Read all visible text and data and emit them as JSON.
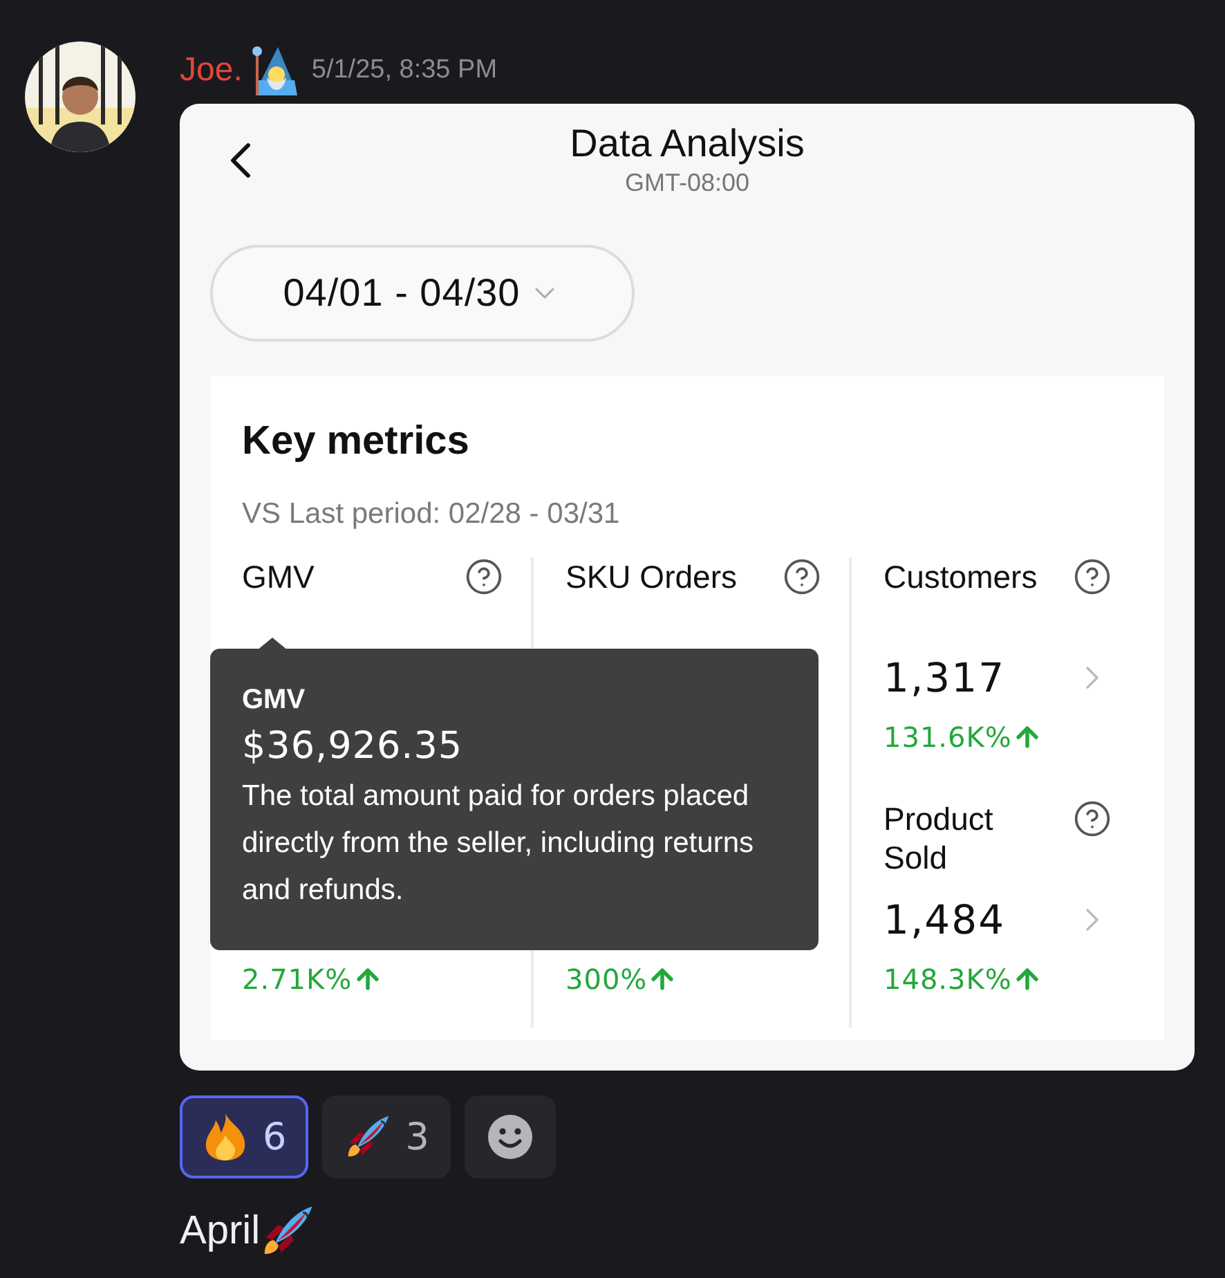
{
  "message": {
    "author": "Joe.",
    "timestamp": "5/1/25, 8:35 PM",
    "text": "April"
  },
  "screenshot": {
    "title": "Data Analysis",
    "timezone": "GMT-08:00",
    "date_range": "04/01 - 04/30",
    "key_metrics": {
      "title": "Key metrics",
      "comparison": "VS Last period: 02/28 - 03/31",
      "metrics": [
        {
          "label": "GMV"
        },
        {
          "label": "SKU Orders"
        },
        {
          "label": "Customers",
          "value": "1,317",
          "change": "131.6K%"
        },
        {
          "change": "2.71K%"
        },
        {
          "change": "300%"
        },
        {
          "label": "Product\nSold",
          "value": "1,484",
          "change": "148.3K%"
        }
      ]
    },
    "tooltip": {
      "title": "GMV",
      "value": "$36,926.35",
      "description": "The total amount paid for orders placed directly from the seller, including returns and refunds."
    }
  },
  "reactions": [
    {
      "kind": "fire",
      "count": "6",
      "selected": true
    },
    {
      "kind": "rocket",
      "count": "3",
      "selected": false
    },
    {
      "kind": "add"
    }
  ]
}
